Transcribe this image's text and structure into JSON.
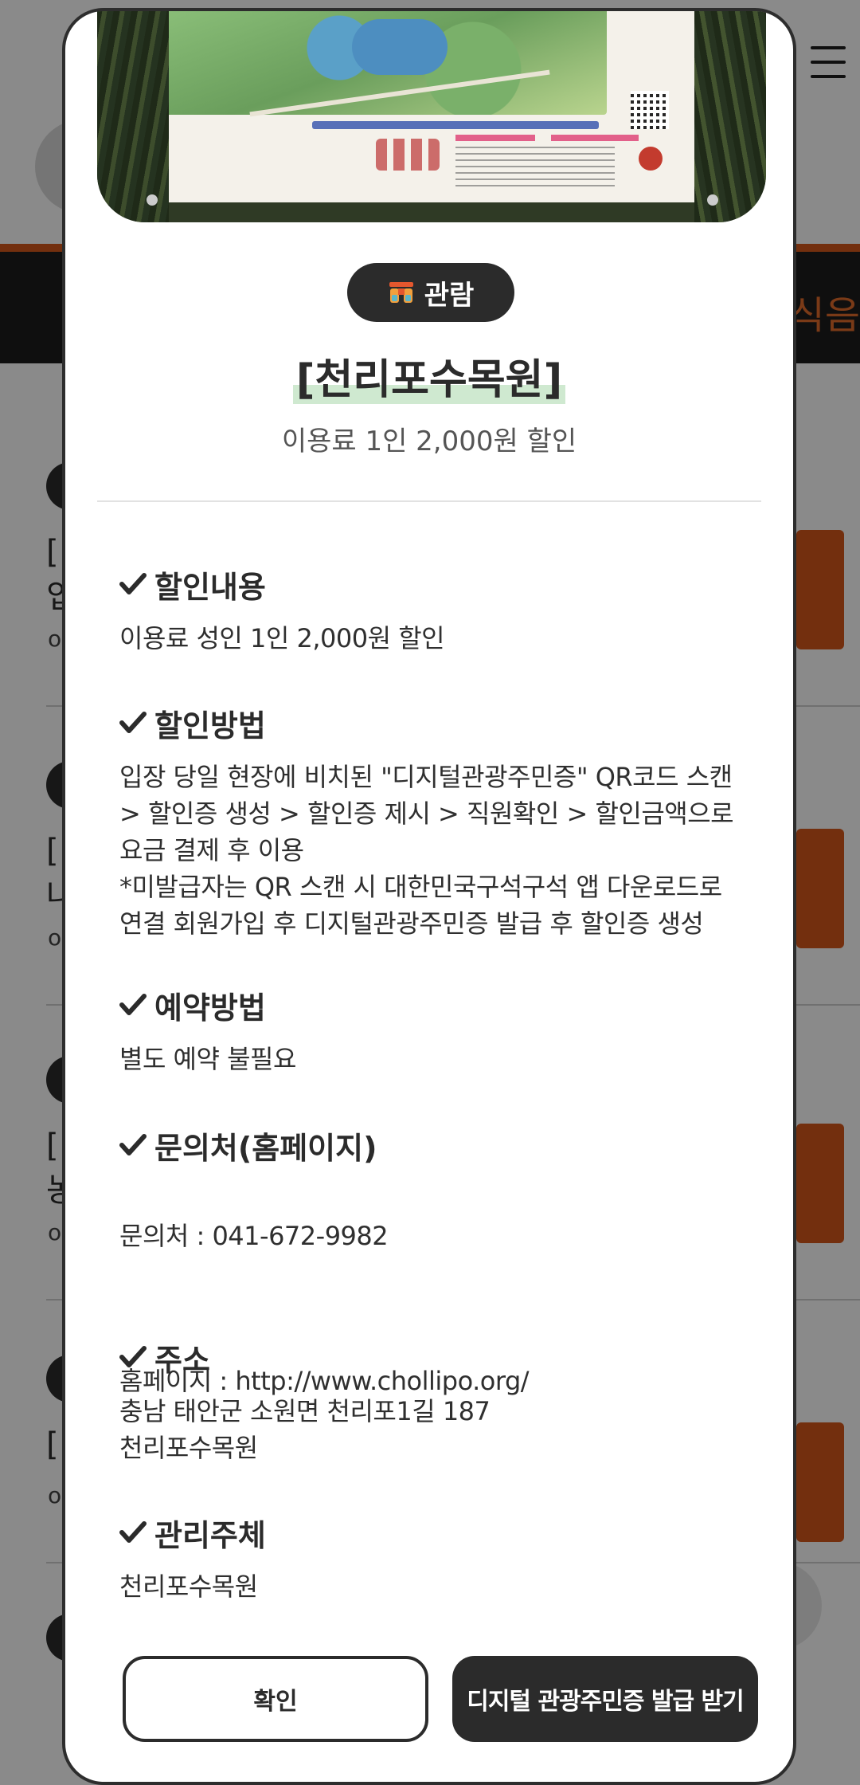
{
  "background": {
    "banner_text": "식음"
  },
  "modal": {
    "category": "관람",
    "title": "[천리포수목원]",
    "subtitle": "이용료 1인 2,000원 할인",
    "sections": [
      {
        "heading": "할인내용",
        "body": "이용료 성인 1인 2,000원 할인"
      },
      {
        "heading": "할인방법",
        "body": "입장 당일 현장에 비치된 \"디지털관광주민증\" QR코드 스캔 > 할인증 생성 > 할인증 제시 > 직원확인 > 할인금액으로 요금 결제 후 이용\n*미발급자는 QR 스캔 시 대한민국구석구석 앱 다운로드로 연결 회원가입 후 디지털관광주민증 발급 후 할인증 생성"
      },
      {
        "heading": "예약방법",
        "body": "별도 예약 불필요"
      },
      {
        "heading": "문의처(홈페이지)",
        "contact": "문의처 : 041-672-9982",
        "homepage": "홈페이지 : http://www.chollipo.org/"
      },
      {
        "heading": "주소",
        "body": "충남 태안군 소원면 천리포1길 187\n천리포수목원"
      },
      {
        "heading": "관리주체",
        "body": "천리포수목원"
      }
    ],
    "buttons": {
      "confirm": "확인",
      "issue": "디지털 관광주민증 발급 받기"
    }
  },
  "icons": {
    "check": "check-icon",
    "category": "binoculars-icon"
  }
}
